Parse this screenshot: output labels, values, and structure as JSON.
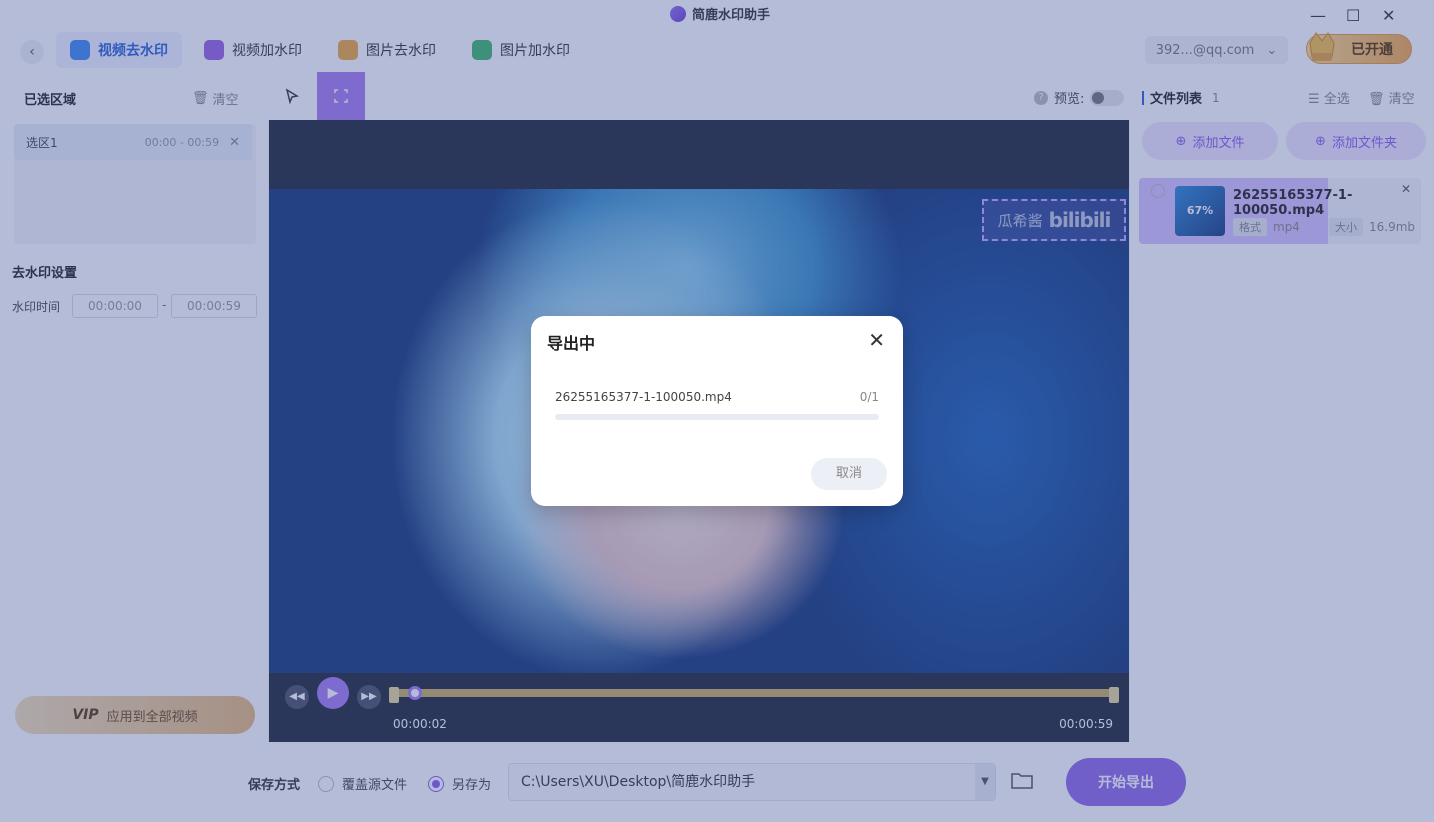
{
  "app": {
    "title": "简鹿水印助手"
  },
  "tabs": [
    {
      "label": "视频去水印",
      "active": true
    },
    {
      "label": "视频加水印"
    },
    {
      "label": "图片去水印"
    },
    {
      "label": "图片加水印"
    }
  ],
  "account": {
    "email": "392...@qq.com",
    "vip_label": "已开通"
  },
  "left": {
    "selected_title": "已选区域",
    "clear": "清空",
    "selection": {
      "name": "选区1",
      "range": "00:00 - 00:59"
    },
    "settings_title": "去水印设置",
    "time_label": "水印时间",
    "time_start": "00:00:00",
    "time_end": "00:00:59",
    "dash": "-",
    "apply_vip": "VIP",
    "apply_label": "应用到全部视频"
  },
  "center": {
    "preview_label": "预览:",
    "watermark_text": "瓜希酱",
    "watermark_logo": "bilibili",
    "time_current": "00:00:02",
    "time_total": "00:00:59",
    "progress_fraction": 0.03
  },
  "right": {
    "title": "文件列表",
    "count": "1",
    "select_all": "全选",
    "clear": "清空",
    "add_file": "添加文件",
    "add_folder": "添加文件夹",
    "file": {
      "name": "26255165377-1-100050.mp4",
      "percent": "67%",
      "format_label": "格式",
      "format": "mp4",
      "size_label": "大小",
      "size": "16.9mb"
    }
  },
  "bottom": {
    "save_label": "保存方式",
    "overwrite": "覆盖源文件",
    "save_as": "另存为",
    "path": "C:\\Users\\XU\\Desktop\\简鹿水印助手",
    "export": "开始导出"
  },
  "dialog": {
    "title": "导出中",
    "file": "26255165377-1-100050.mp4",
    "count": "0/1",
    "cancel": "取消"
  },
  "colors": {
    "accent": "#9068e8",
    "blue": "#2b63d9",
    "vip": "#f4a94a"
  }
}
